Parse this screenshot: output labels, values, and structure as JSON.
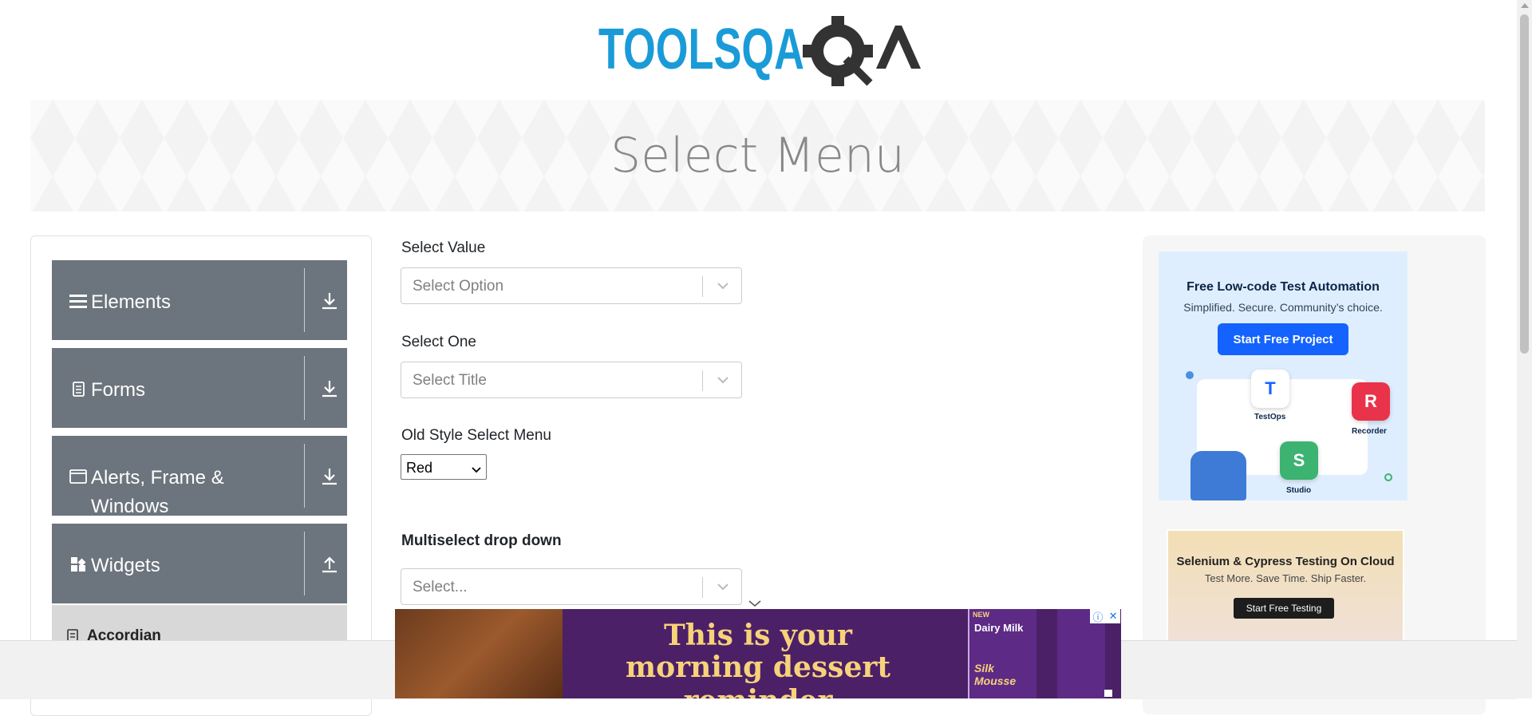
{
  "logo": {
    "text": "TOOLSQA"
  },
  "header": {
    "title": "Select Menu"
  },
  "sidebar": {
    "groups": [
      {
        "label": "Elements",
        "icon": "hamburger-icon",
        "state_icon": "download-arrow-icon"
      },
      {
        "label": "Forms",
        "icon": "document-icon",
        "state_icon": "download-arrow-icon"
      },
      {
        "label": "Alerts, Frame & Windows",
        "icon": "window-icon",
        "state_icon": "download-arrow-icon"
      },
      {
        "label": "Widgets",
        "icon": "widgets-icon",
        "state_icon": "upload-arrow-icon"
      }
    ],
    "active_item": {
      "label": "Accordian",
      "icon": "document-icon"
    }
  },
  "form": {
    "select_value": {
      "label": "Select Value",
      "placeholder": "Select Option"
    },
    "select_one": {
      "label": "Select One",
      "placeholder": "Select Title"
    },
    "old_style": {
      "label": "Old Style Select Menu",
      "value": "Red"
    },
    "multiselect": {
      "label": "Multiselect drop down",
      "placeholder": "Select..."
    }
  },
  "ads": {
    "ad1": {
      "title": "Free Low-code Test Automation",
      "subtitle": "Simplified. Secure. Community’s choice.",
      "button": "Start Free Project",
      "badges": [
        "TestOps",
        "Recorder",
        "Studio"
      ],
      "badge_letters": [
        "T",
        "R",
        "S"
      ]
    },
    "ad2": {
      "title": "Selenium & Cypress Testing On Cloud",
      "subtitle": "Test More. Save Time. Ship Faster.",
      "button": "Start Free Testing"
    },
    "bottom": {
      "line1": "This is your",
      "line2": "morning dessert reminder",
      "brand": "Dairy Milk",
      "product": "Silk Mousse",
      "badge": "NEW"
    }
  },
  "colors": {
    "accent_blue": "#1a9bd8",
    "panel_gray": "#6c757d",
    "logo_dark": "#333333"
  }
}
